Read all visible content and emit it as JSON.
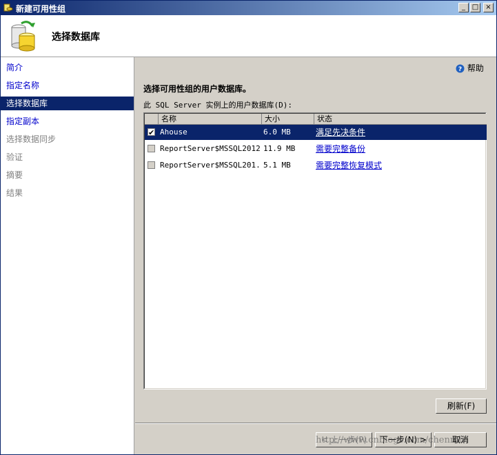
{
  "window": {
    "title": "新建可用性组",
    "minimize": "_",
    "maximize": "□",
    "close": "×"
  },
  "header": {
    "title": "选择数据库"
  },
  "sidebar": {
    "items": [
      {
        "label": "简介",
        "state": "link"
      },
      {
        "label": "指定名称",
        "state": "link"
      },
      {
        "label": "选择数据库",
        "state": "active"
      },
      {
        "label": "指定副本",
        "state": "link"
      },
      {
        "label": "选择数据同步",
        "state": "disabled"
      },
      {
        "label": "验证",
        "state": "disabled"
      },
      {
        "label": "摘要",
        "state": "disabled"
      },
      {
        "label": "结果",
        "state": "disabled"
      }
    ]
  },
  "main": {
    "help": "帮助",
    "section_title": "选择可用性组的用户数据库。",
    "list_label": "此 SQL Server 实例上的用户数据库(D):",
    "columns": {
      "name": "名称",
      "size": "大小",
      "status": "状态"
    },
    "rows": [
      {
        "name": "Ahouse",
        "size": "6.0 MB",
        "status": "满足先决条件",
        "checked": true,
        "selected": true
      },
      {
        "name": "ReportServer$MSSQL2012",
        "size": "11.9 MB",
        "status": "需要完整备份",
        "checked": false,
        "selected": false
      },
      {
        "name": "ReportServer$MSSQL201...",
        "size": "5.1 MB",
        "status": "需要完整恢复模式",
        "checked": false,
        "selected": false
      }
    ],
    "refresh": "刷新(F)"
  },
  "footer": {
    "prev": "< 上一步(P)",
    "next": "下一步(N) >",
    "cancel": "取消",
    "watermark": "http://www.cnblogs.com/chenmh"
  },
  "colors": {
    "selection": "#0a246a",
    "link": "#0000cc",
    "face": "#d4d0c8"
  }
}
